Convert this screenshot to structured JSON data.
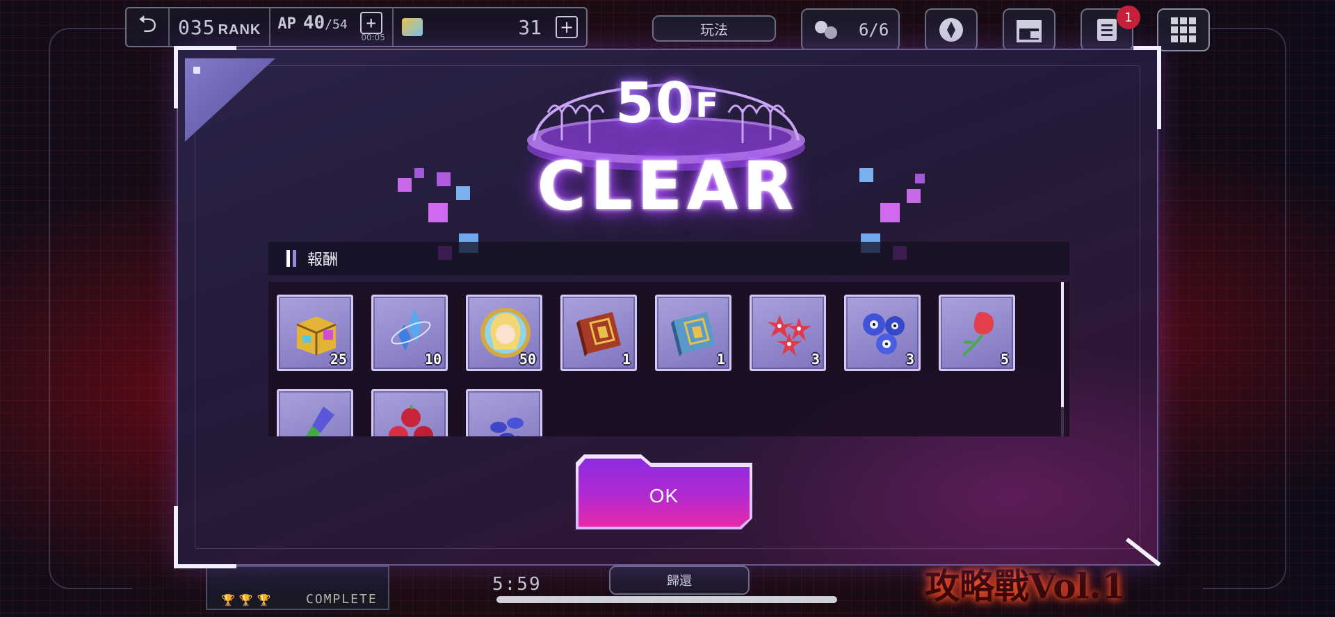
{
  "hud": {
    "rank_number": "035",
    "rank_label": "RANK",
    "ap_label": "AP",
    "ap_current": "40",
    "ap_max": "/54",
    "ap_timer": "00:05",
    "gems": "31",
    "howto_label": "玩法",
    "party_count": "6/6",
    "notice_badge": "1"
  },
  "modal": {
    "floor_number": "50",
    "floor_unit": "F",
    "clear_text": "CLEAR",
    "reward_title": "報酬",
    "ok_label": "OK"
  },
  "rewards": [
    {
      "icon": "treasure-chest",
      "qty": "25"
    },
    {
      "icon": "blue-crystal",
      "qty": "10"
    },
    {
      "icon": "character-medal",
      "qty": "50"
    },
    {
      "icon": "red-book",
      "qty": "1"
    },
    {
      "icon": "blue-book",
      "qty": "1"
    },
    {
      "icon": "red-flowers",
      "qty": "3"
    },
    {
      "icon": "blue-flowers",
      "qty": "3"
    },
    {
      "icon": "red-tulip",
      "qty": "5"
    },
    {
      "icon": "paint-brush",
      "qty": ""
    },
    {
      "icon": "red-fruits",
      "qty": ""
    },
    {
      "icon": "blue-berries",
      "qty": ""
    }
  ],
  "background": {
    "complete_label": "COMPLETE",
    "timer": "5:59",
    "return_label": "歸還",
    "event_title": "攻略戰Vol.1"
  },
  "colors": {
    "accent": "#b14dff",
    "ok_button": "#b32ad0",
    "badge": "#c8203a"
  }
}
